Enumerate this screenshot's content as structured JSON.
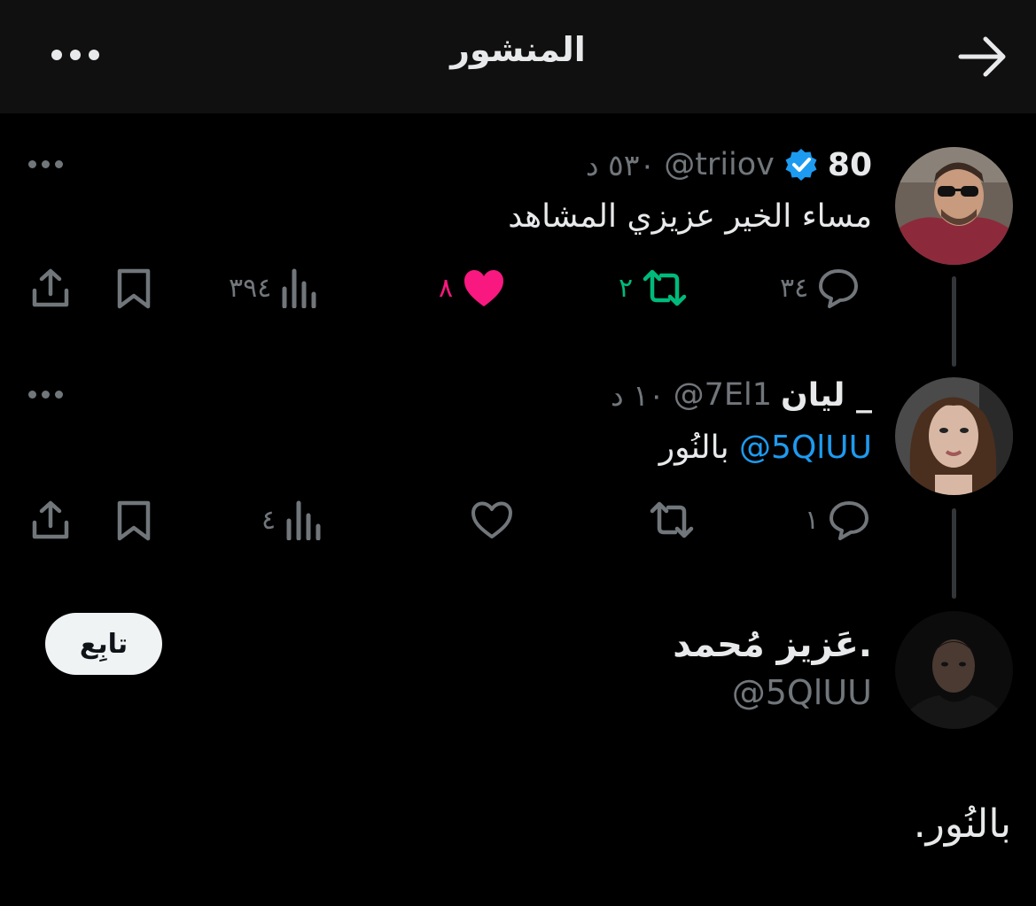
{
  "header": {
    "title": "المنشور",
    "back_icon": "arrow-right-icon",
    "more_icon": "more-horizontal-icon"
  },
  "post1": {
    "name": "80",
    "handle": "@triiov",
    "time": "٥٣٠ د",
    "text": "مساء الخير عزيزي المشاهد",
    "verified": true,
    "actions": {
      "replies": "٣٤",
      "reposts": "٢",
      "likes": "٨",
      "views": "٣٩٤"
    }
  },
  "post2": {
    "name": "ليان _",
    "handle": "@7El1",
    "time": "١٠ د",
    "mention": "@5QlUU",
    "text": "بالنُور",
    "actions": {
      "replies": "١",
      "views": "٤"
    }
  },
  "profile": {
    "name": "عَزيز مُحمد.",
    "handle": "@5QlUU",
    "follow_label": "تابِع",
    "text": "بالنُور."
  },
  "colors": {
    "accent": "#1d9bf0",
    "repost": "#00ba7c",
    "like": "#f91880",
    "muted": "#71767b"
  }
}
